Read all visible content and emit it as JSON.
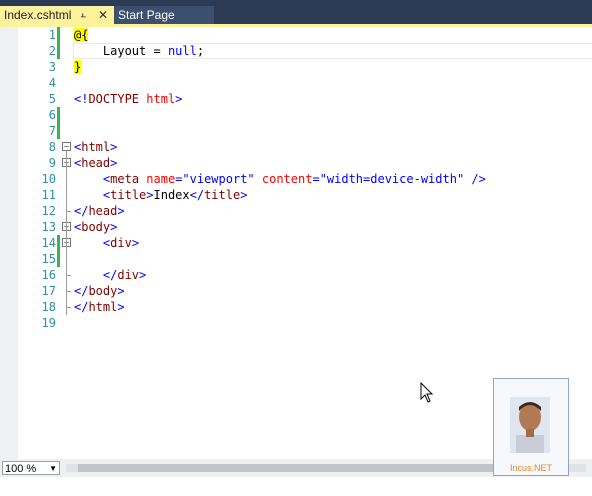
{
  "tabs": [
    {
      "label": "Index.cshtml",
      "active": true
    },
    {
      "label": "Start Page",
      "active": false
    }
  ],
  "tab_icons": {
    "pin": "pin-icon",
    "close": "close-icon"
  },
  "line_numbers": [
    "1",
    "2",
    "3",
    "4",
    "5",
    "6",
    "7",
    "8",
    "9",
    "10",
    "11",
    "12",
    "13",
    "14",
    "15",
    "16",
    "17",
    "18",
    "19"
  ],
  "code": {
    "l1": {
      "razor": "@{"
    },
    "l2": {
      "indent": "    ",
      "text": "Layout = ",
      "kw": "null",
      "end": ";"
    },
    "l3": {
      "razor": "}"
    },
    "l5": {
      "lt": "<!",
      "tag": "DOCTYPE",
      "sp": " ",
      "attr": "html",
      "gt": ">"
    },
    "l8": {
      "lt": "<",
      "tag": "html",
      "gt": ">"
    },
    "l9": {
      "lt": "<",
      "tag": "head",
      "gt": ">"
    },
    "l10": {
      "indent": "    ",
      "lt": "<",
      "tag": "meta",
      "a1": " name",
      "eq1": "=",
      "v1": "\"viewport\"",
      "a2": " content",
      "eq2": "=",
      "v2": "\"width=device-width\"",
      "end": " />"
    },
    "l11": {
      "indent": "    ",
      "lt": "<",
      "tag": "title",
      "gt": ">",
      "text": "Index",
      "lt2": "</",
      "tag2": "title",
      "gt2": ">"
    },
    "l12": {
      "lt": "</",
      "tag": "head",
      "gt": ">"
    },
    "l13": {
      "lt": "<",
      "tag": "body",
      "gt": ">"
    },
    "l14": {
      "indent": "    ",
      "lt": "<",
      "tag": "div",
      "gt": ">"
    },
    "l16": {
      "indent": "    ",
      "lt": "</",
      "tag": "div",
      "gt": ">"
    },
    "l17": {
      "lt": "</",
      "tag": "body",
      "gt": ">"
    },
    "l18": {
      "lt": "</",
      "tag": "html",
      "gt": ">"
    }
  },
  "zoom": "100 %",
  "avatar_label": "Incus.NET",
  "colors": {
    "accent_tab": "#fff29d",
    "change_bar": "#39b54a",
    "line_number": "#2b91af",
    "tag": "#800000",
    "attr": "#ff0000",
    "keyword": "#0000ff"
  }
}
